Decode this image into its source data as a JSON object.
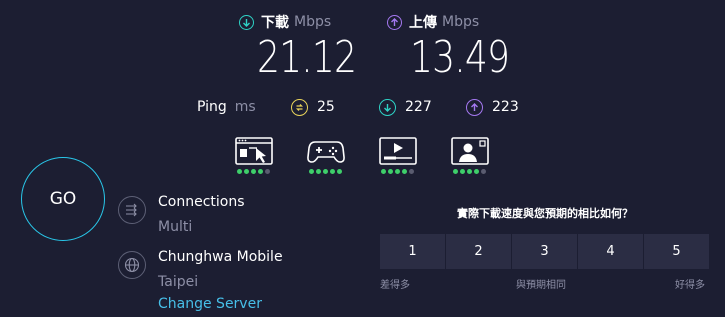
{
  "download": {
    "label": "下載",
    "unit": "Mbps",
    "value": "21.12"
  },
  "upload": {
    "label": "上傳",
    "unit": "Mbps",
    "value": "13.49"
  },
  "ping": {
    "label": "Ping",
    "unit": "ms",
    "idle": "25",
    "download": "227",
    "upload": "223"
  },
  "activities": [
    {
      "icon": "web-browsing-icon",
      "rating": 4,
      "max": 5
    },
    {
      "icon": "gaming-icon",
      "rating": 5,
      "max": 5
    },
    {
      "icon": "video-streaming-icon",
      "rating": 4,
      "max": 5
    },
    {
      "icon": "video-call-icon",
      "rating": 4,
      "max": 5
    }
  ],
  "go_label": "GO",
  "connections": {
    "title": "Connections",
    "value": "Multi"
  },
  "server": {
    "name": "Chunghwa Mobile",
    "location": "Taipei",
    "change_label": "Change Server"
  },
  "survey": {
    "question": "實際下載速度與您預期的相比如何？",
    "options": [
      "1",
      "2",
      "3",
      "4",
      "5"
    ],
    "left_label": "差得多",
    "mid_label": "與預期相同",
    "right_label": "好得多"
  },
  "colors": {
    "background": "#1c1e32",
    "download_accent": "#2ed3c6",
    "upload_accent": "#a478f0",
    "ping_idle_accent": "#e8d35a",
    "go_ring": "#29c6e8",
    "link": "#47bfe8",
    "rating_on": "#3ecf6a"
  }
}
